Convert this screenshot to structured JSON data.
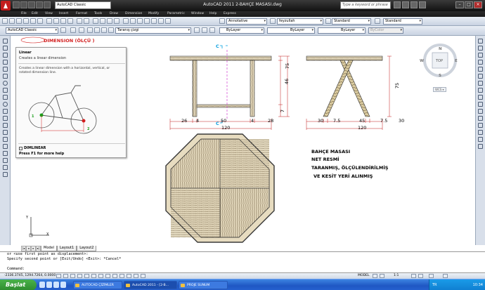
{
  "app": {
    "title": "AutoCAD 2011   2-BAHÇE MASASI.dwg",
    "workspace": "AutoCAD Classic",
    "search_placeholder": "Type a keyword or phrase"
  },
  "menu": [
    "File",
    "Edit",
    "View",
    "Insert",
    "Format",
    "Tools",
    "Draw",
    "Dimension",
    "Modify",
    "Parametric",
    "Window",
    "Help",
    "Express"
  ],
  "styles_toolbar": {
    "annotative": "Annotative",
    "feyzullah": "feyzullah",
    "standard1": "Standard",
    "standard2": "Standard"
  },
  "layers_toolbar": {
    "workspace": "AutoCAD Classic",
    "layer": "Taranış çizgi",
    "color": "ByLayer",
    "linetype": "ByLayer",
    "lineweight": "ByLayer",
    "plotstyle": "ByColor"
  },
  "dimension_label": "DIMENSION (ÖLÇÜ )",
  "tooltip": {
    "heading": "Linear",
    "subtitle": "Creates a linear dimension",
    "description": "Creates a linear dimension with a horizontal, vertical, or rotated dimension line.",
    "command": "DIMLINEAR",
    "help": "Press F1 for more help",
    "p1": "1",
    "p2": "2"
  },
  "viewcube": {
    "top": "TOP",
    "n": "N",
    "s": "S",
    "e": "E",
    "w": "W",
    "wcs": "WCS ▾"
  },
  "drawing": {
    "front_dims": {
      "d26": "26",
      "d4a": "4",
      "d50": "50",
      "d4b": "4",
      "d28": "28",
      "d120": "120",
      "c1": "C",
      "c2": "C",
      "v75": "75",
      "v46": "46",
      "v7": "7"
    },
    "side_dims": {
      "d30a": "30",
      "d75a": "7.5",
      "d45": "45",
      "d75b": "7.5",
      "d30b": "30",
      "d120": "120",
      "v75": "75"
    },
    "notes": [
      "BAHÇE MASASI",
      "NET RESMİ",
      "TARANMIŞ, ÖLÇÜLENDİRİLMİŞ",
      "VE KESİT YERİ ALINMIŞ"
    ]
  },
  "ucs": {
    "x": "X",
    "y": "Y"
  },
  "tabs": [
    "Model",
    "Layout1",
    "Layout2"
  ],
  "command_lines": [
    "or <use first point as displacement>:",
    "Specify second point or [Exit/Undo] <Exit>: *Cancel*",
    "",
    "Command:"
  ],
  "status": {
    "coords": "-2336.3745, 1294.7264, 0.0000",
    "model": "MODEL",
    "scale": "1:1"
  },
  "taskbar": {
    "start": "Başlat",
    "items": [
      "AUTOCAD ÇİZİMLER",
      "AutoCAD 2011 - [2-B...",
      "PROJE SUNUM"
    ],
    "tray_text": "TR",
    "clock": "10:34"
  }
}
